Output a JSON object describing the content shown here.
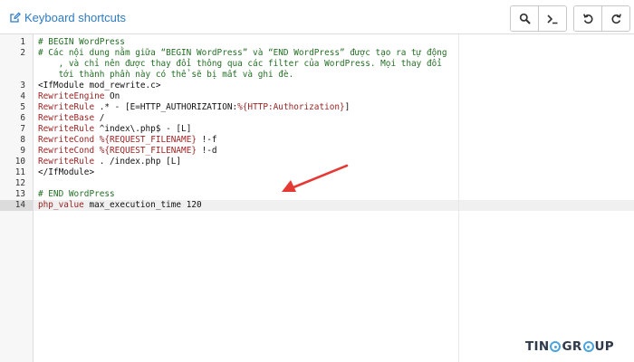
{
  "toolbar": {
    "shortcuts_label": "Keyboard shortcuts",
    "buttons": [
      {
        "name": "search-button",
        "icon": "search-icon"
      },
      {
        "name": "terminal-button",
        "icon": "terminal-icon"
      },
      {
        "name": "undo-button",
        "icon": "undo-icon"
      },
      {
        "name": "redo-button",
        "icon": "redo-icon"
      }
    ]
  },
  "editor": {
    "active_line": "14",
    "lines": [
      {
        "no": "1",
        "text": "# BEGIN WordPress",
        "style": "comment"
      },
      {
        "no": "2",
        "text": "# Các nội dung nằm giữa “BEGIN WordPress” và “END WordPress” được tạo ra tự động",
        "style": "comment"
      },
      {
        "no": "",
        "text": "    , và chỉ nên được thay đổi thông qua các filter của WordPress. Mọi thay đổi",
        "style": "comment"
      },
      {
        "no": "",
        "text": "    tới thành phần này có thể sẽ bị mất và ghi đè.",
        "style": "comment"
      },
      {
        "no": "3",
        "text": "<IfModule mod_rewrite.c>",
        "style": "tag"
      },
      {
        "no": "4",
        "kw": "RewriteEngine",
        "rest": " On"
      },
      {
        "no": "5",
        "kw": "RewriteRule",
        "rest": " .* - [E=HTTP_AUTHORIZATION:",
        "var": "%{HTTP:Authorization}",
        "rest2": "]"
      },
      {
        "no": "6",
        "kw": "RewriteBase",
        "rest": " /"
      },
      {
        "no": "7",
        "kw": "RewriteRule",
        "rest": " ^index\\.php$ - [L]"
      },
      {
        "no": "8",
        "kw": "RewriteCond",
        "rest": " ",
        "var": "%{REQUEST_FILENAME}",
        "rest2": " !-f"
      },
      {
        "no": "9",
        "kw": "RewriteCond",
        "rest": " ",
        "var": "%{REQUEST_FILENAME}",
        "rest2": " !-d"
      },
      {
        "no": "10",
        "kw": "RewriteRule",
        "rest": " . /index.php [L]"
      },
      {
        "no": "11",
        "text": "</IfModule>",
        "style": "tag"
      },
      {
        "no": "12",
        "text": "",
        "style": "tag"
      },
      {
        "no": "13",
        "text": "# END WordPress",
        "style": "comment"
      },
      {
        "no": "14",
        "kw": "php_value",
        "rest": " max_execution_time 120"
      }
    ]
  },
  "colors": {
    "link": "#2d7bc4",
    "comment": "#236e24",
    "keyword": "#9a1f1f",
    "arrow": "#e53935",
    "logo_text": "#2f3a4b",
    "logo_accent": "#4aa3df"
  },
  "logo": {
    "left": "TIN",
    "middle": "GR",
    "right": "UP"
  }
}
